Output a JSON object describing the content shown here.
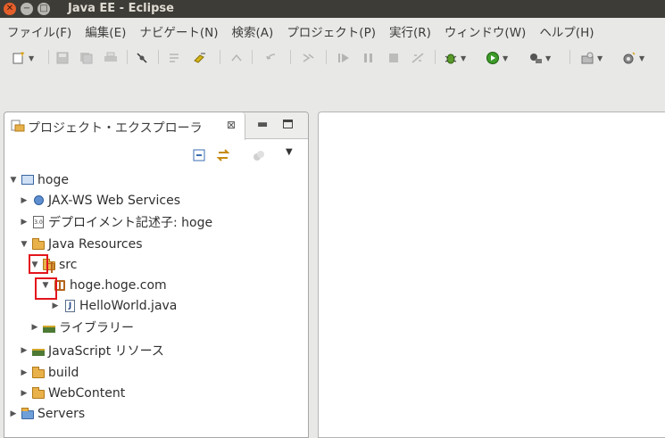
{
  "window": {
    "title": "Java EE - Eclipse",
    "close_glyph": "✕",
    "min_glyph": "−",
    "max_glyph": "□"
  },
  "menubar": {
    "items": [
      "ファイル(F)",
      "編集(E)",
      "ナビゲート(N)",
      "検索(A)",
      "プロジェクト(P)",
      "実行(R)",
      "ウィンドウ(W)",
      "ヘルプ(H)"
    ]
  },
  "toolbar": {
    "dropdown_glyph": "▼"
  },
  "panel": {
    "title": "プロジェクト・エクスプローラ",
    "close_glyph": "⊠",
    "minimize_glyph": "▬",
    "view_menu_glyph": "▼"
  },
  "tree": {
    "hoge": "hoge",
    "jaxws": "JAX-WS Web Services",
    "deploy": "デプロイメント記述子: hoge",
    "java_resources": "Java Resources",
    "src": "src",
    "package": "hoge.hoge.com",
    "helloworld": "HelloWorld.java",
    "library": "ライブラリー",
    "javascript": "JavaScript リソース",
    "build": "build",
    "webcontent": "WebContent",
    "servers": "Servers",
    "expanded_glyph": "▼",
    "collapsed_glyph": "▶",
    "deploy_icon_text": "3.0",
    "java_file_letter": "J"
  }
}
